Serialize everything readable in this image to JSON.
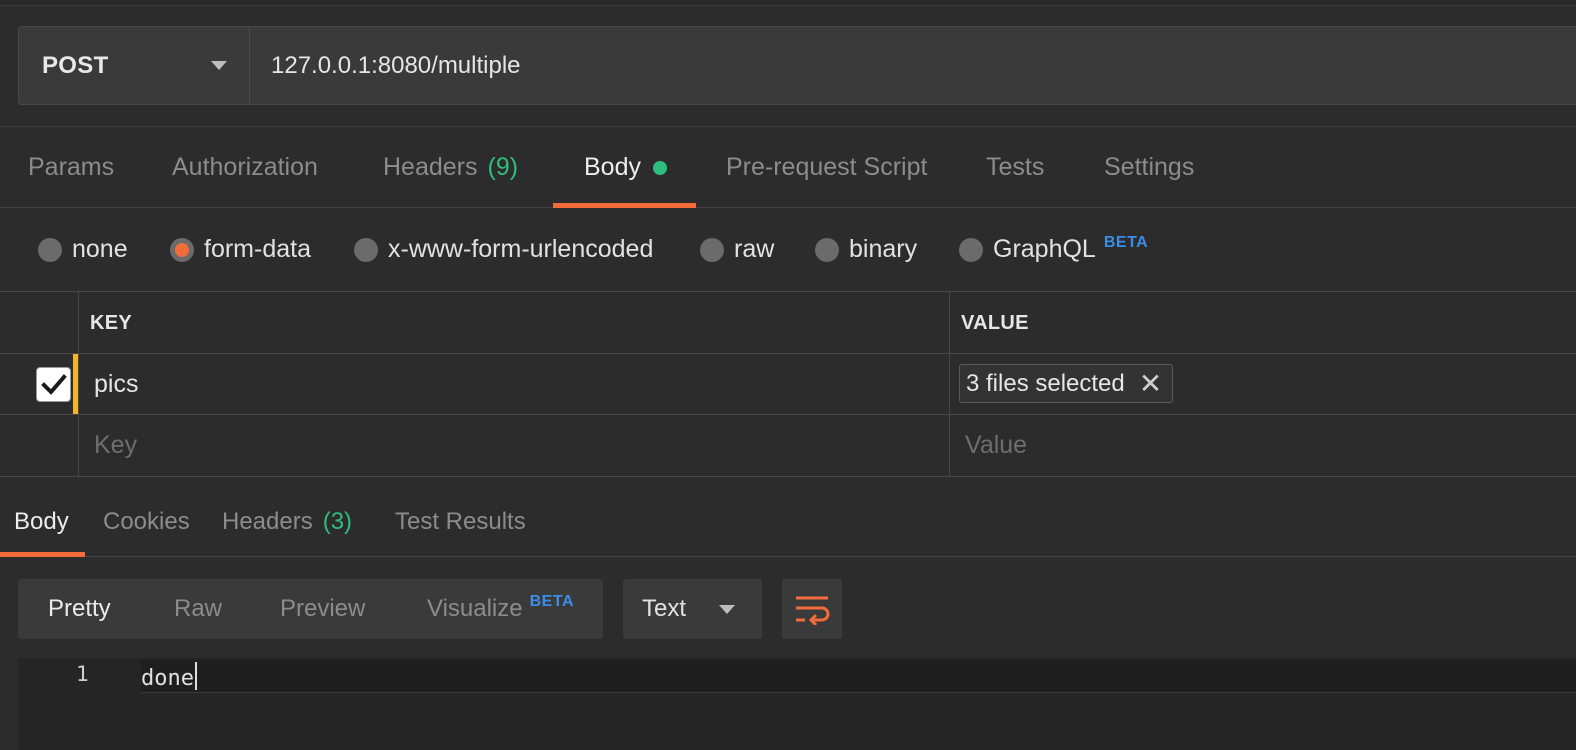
{
  "request": {
    "method": "POST",
    "url": "127.0.0.1:8080/multiple"
  },
  "request_tabs": [
    {
      "label": "Params"
    },
    {
      "label": "Authorization"
    },
    {
      "label": "Headers",
      "count": "(9)"
    },
    {
      "label": "Body",
      "active": true,
      "indicator": "green-dot"
    },
    {
      "label": "Pre-request Script"
    },
    {
      "label": "Tests"
    },
    {
      "label": "Settings"
    }
  ],
  "body_types": {
    "options": [
      {
        "label": "none"
      },
      {
        "label": "form-data",
        "selected": true
      },
      {
        "label": "x-www-form-urlencoded"
      },
      {
        "label": "raw"
      },
      {
        "label": "binary"
      },
      {
        "label": "GraphQL",
        "badge": "BETA"
      }
    ]
  },
  "form_table": {
    "headers": {
      "key": "KEY",
      "value": "VALUE"
    },
    "rows": [
      {
        "checked": true,
        "key": "pics",
        "value": "3 files selected"
      }
    ],
    "placeholder": {
      "key": "Key",
      "value": "Value"
    }
  },
  "response_tabs": [
    {
      "label": "Body",
      "active": true
    },
    {
      "label": "Cookies"
    },
    {
      "label": "Headers",
      "count": "(3)"
    },
    {
      "label": "Test Results"
    }
  ],
  "response_view": {
    "modes": [
      {
        "label": "Pretty",
        "active": true
      },
      {
        "label": "Raw"
      },
      {
        "label": "Preview"
      },
      {
        "label": "Visualize",
        "badge": "BETA"
      }
    ],
    "format": "Text",
    "wrap_icon": "wrap-lines-icon"
  },
  "response_body": {
    "lines": [
      {
        "number": "1",
        "text": "done"
      }
    ]
  },
  "colors": {
    "accent": "#f26b3a",
    "count_green": "#2fbd7e",
    "beta_blue": "#3a8de8",
    "modified_bar": "#f5b32b"
  }
}
